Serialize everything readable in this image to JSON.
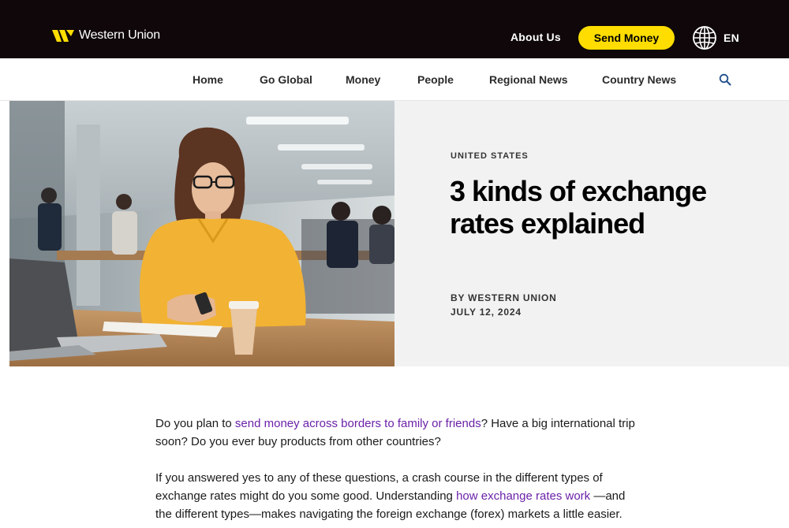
{
  "header": {
    "logo_text": "Western Union",
    "about_label": "About Us",
    "send_money_label": "Send Money",
    "language": "EN",
    "brand_yellow": "#ffdd00",
    "bar_color": "#0f0709"
  },
  "nav": {
    "items": [
      "Home",
      "Go Global",
      "Money",
      "People",
      "Regional News",
      "Country News"
    ],
    "search_icon": "search-icon"
  },
  "hero": {
    "eyebrow": "UNITED STATES",
    "title": "3 kinds of exchange rates explained",
    "byline": "BY WESTERN UNION",
    "date": "JULY 12, 2024"
  },
  "article": {
    "p1_a": "Do you plan to ",
    "p1_link": "send money across borders to family or friends",
    "p1_b": "? Have a big international trip soon? Do you ever buy products from other countries?",
    "p2_a": "If you answered yes to any of these questions, a crash course in the different types of exchange rates might do you some good. Understanding ",
    "p2_link": "how exchange rates work",
    "p2_b": " —and the different types—makes navigating the foreign exchange (forex) markets a little easier.",
    "link_color": "#6b21a8"
  }
}
